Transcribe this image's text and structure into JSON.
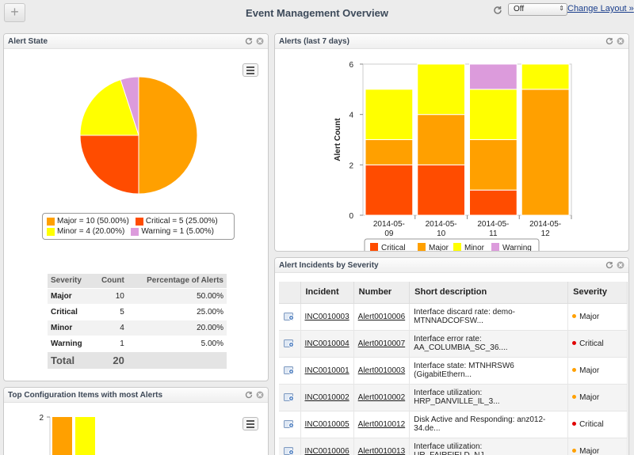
{
  "header": {
    "title": "Event Management Overview",
    "add_label": "+",
    "refresh_select_value": "Off",
    "change_layout_label": "Change Layout »"
  },
  "colors": {
    "critical": "#ff4c00",
    "major": "#ffa000",
    "minor": "#ffff00",
    "warning": "#dc9bdc",
    "link": "#1a3e8c"
  },
  "alert_state": {
    "title": "Alert State",
    "legend": [
      {
        "label": "Major = 10 (50.00%)",
        "color": "#ffa000"
      },
      {
        "label": "Critical = 5 (25.00%)",
        "color": "#ff4c00"
      },
      {
        "label": "Minor = 4 (20.00%)",
        "color": "#ffff00"
      },
      {
        "label": "Warning = 1 (5.00%)",
        "color": "#dc9bdc"
      }
    ],
    "table": {
      "headers": [
        "Severity",
        "Count",
        "Percentage of Alerts"
      ],
      "rows": [
        [
          "Major",
          "10",
          "50.00%"
        ],
        [
          "Critical",
          "5",
          "25.00%"
        ],
        [
          "Minor",
          "4",
          "20.00%"
        ],
        [
          "Warning",
          "1",
          "5.00%"
        ]
      ],
      "total_label": "Total",
      "total_value": "20"
    }
  },
  "alerts_7days": {
    "title": "Alerts (last 7 days)",
    "ylabel": "Alert Count",
    "legend": [
      "Critical",
      "Major",
      "Minor",
      "Warning"
    ]
  },
  "chart_data": [
    {
      "type": "pie",
      "labels": [
        "Major",
        "Critical",
        "Minor",
        "Warning"
      ],
      "values": [
        10,
        5,
        4,
        1
      ],
      "colors": [
        "#ffa000",
        "#ff4c00",
        "#ffff00",
        "#dc9bdc"
      ]
    },
    {
      "type": "bar",
      "stacked": true,
      "categories": [
        "2014-05-09",
        "2014-05-10",
        "2014-05-11",
        "2014-05-12"
      ],
      "category_lines": [
        [
          "2014-05-",
          "09"
        ],
        [
          "2014-05-",
          "10"
        ],
        [
          "2014-05-",
          "11"
        ],
        [
          "2014-05-",
          "12"
        ]
      ],
      "series": [
        {
          "name": "Critical",
          "color": "#ff4c00",
          "values": [
            2,
            2,
            1,
            0
          ]
        },
        {
          "name": "Major",
          "color": "#ffa000",
          "values": [
            1,
            2,
            2,
            5
          ]
        },
        {
          "name": "Minor",
          "color": "#ffff00",
          "values": [
            2,
            2,
            2,
            1
          ]
        },
        {
          "name": "Warning",
          "color": "#dc9bdc",
          "values": [
            0,
            0,
            1,
            0
          ]
        }
      ],
      "ylabel": "Alert Count",
      "ylim": [
        0,
        6
      ],
      "yticks": [
        0,
        2,
        4,
        6
      ],
      "legend": "bottom"
    },
    {
      "type": "bar",
      "categories": [
        "",
        ""
      ],
      "values": [
        2,
        2
      ],
      "colors": [
        "#ffa000",
        "#ffff00"
      ],
      "ylim": [
        0,
        2
      ],
      "yticks": [
        2
      ]
    }
  ],
  "incidents": {
    "title": "Alert Incidents by Severity",
    "headers": [
      "Incident",
      "Number",
      "Short description",
      "Severity"
    ],
    "rows": [
      {
        "incident": "INC0010003",
        "number": "Alert0010006",
        "desc1": "Interface discard rate: demo-",
        "desc2": "MTNNADCOFSW...",
        "severity": "Major",
        "color": "#ffa000"
      },
      {
        "incident": "INC0010004",
        "number": "Alert0010007",
        "desc1": "Interface error rate:",
        "desc2": "AA_COLUMBIA_SC_36....",
        "severity": "Critical",
        "color": "#e00000"
      },
      {
        "incident": "INC0010001",
        "number": "Alert0010003",
        "desc1": "Interface state: MTNHRSW6",
        "desc2": "(GigabitEthern...",
        "severity": "Major",
        "color": "#ffa000"
      },
      {
        "incident": "INC0010002",
        "number": "Alert0010002",
        "desc1": "Interface utilization:",
        "desc2": "HRP_DANVILLE_IL_3...",
        "severity": "Major",
        "color": "#ffa000"
      },
      {
        "incident": "INC0010005",
        "number": "Alert0010012",
        "desc1": "Disk Active and Responding: anz012-",
        "desc2": "34.de...",
        "severity": "Critical",
        "color": "#e00000"
      },
      {
        "incident": "INC0010006",
        "number": "Alert0010013",
        "desc1": "Interface utilization:",
        "desc2": "UR_FAIRFIELD_NJ",
        "severity": "Major",
        "color": "#ffa000"
      }
    ]
  },
  "top_ci": {
    "title": "Top Configuration Items with most Alerts"
  }
}
